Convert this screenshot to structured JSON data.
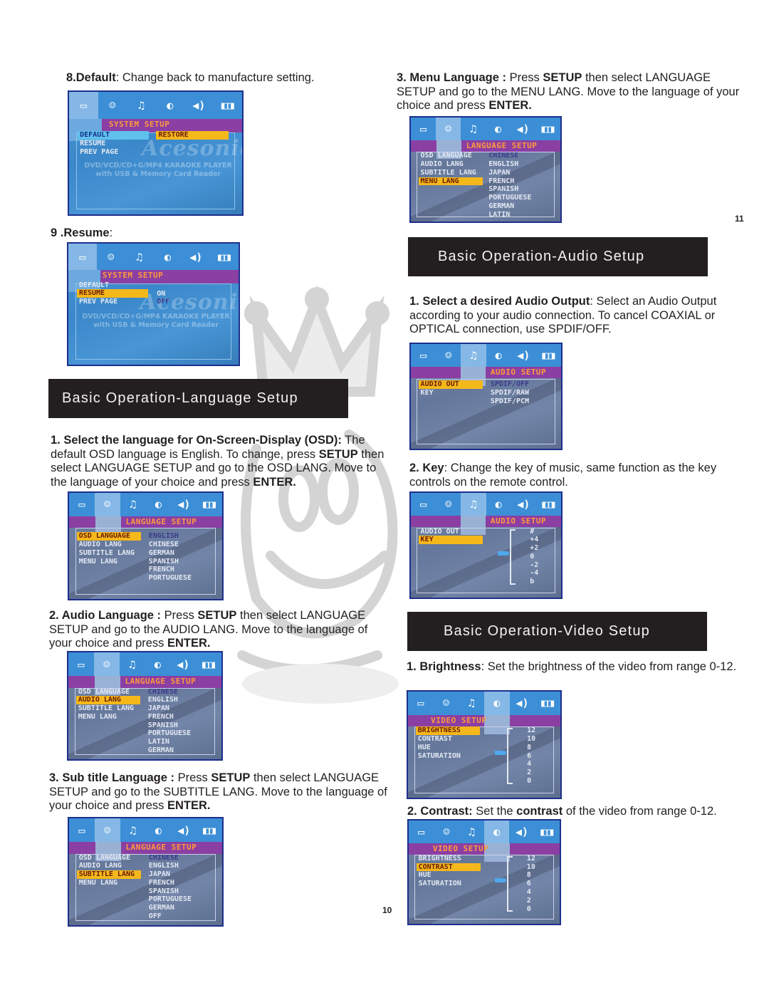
{
  "page_numbers": {
    "left": "10",
    "right": "11"
  },
  "osd_tabs": [
    {
      "icon": "monitor-icon",
      "glyph": "▭"
    },
    {
      "icon": "language-person-icon",
      "glyph": "☺"
    },
    {
      "icon": "music-note-icon",
      "glyph": "♫"
    },
    {
      "icon": "video-disc-icon",
      "glyph": "◐"
    },
    {
      "icon": "speaker-icon",
      "glyph": "◀)"
    },
    {
      "icon": "dolby-icon",
      "glyph": "◧◨"
    }
  ],
  "left": {
    "default": {
      "num": "8.",
      "label": "Default",
      "text": ": Change back to manufacture setting.",
      "screen": {
        "title": "SYSTEM SETUP",
        "items": [
          "DEFAULT",
          "RESUME",
          "PREV PAGE"
        ],
        "selected_item": "DEFAULT",
        "option": "RESTORE",
        "brand": "Acesonic",
        "brand_line1": "DVD/VCD/CD+G/MP4 KARAOKE PLAYER",
        "brand_line2": "with USB & Memory Card Reader"
      }
    },
    "resume": {
      "num": "9 .",
      "label": "Resume",
      "text": ":",
      "screen": {
        "title": "SYSTEM SETUP",
        "items": [
          "DEFAULT",
          "RESUME",
          "PREV PAGE"
        ],
        "selected_item": "RESUME",
        "options": [
          "ON",
          "OFF"
        ],
        "brand": "Acesonic",
        "brand_line1": "DVD/VCD/CD+G/MP4 KARAOKE PLAYER",
        "brand_line2": "with USB & Memory Card Reader"
      }
    },
    "language_banner": "Basic Operation-Language Setup",
    "osd_lang": {
      "bold": "1. Select the language for On-Screen-Display (OSD):",
      "t1": " The default OSD language is English. To change, press ",
      "b2": "SETUP",
      "t2": " then select LANGUAGE  SETUP and go to the OSD LANG. Move to the language of your choice and press ",
      "b3": "ENTER.",
      "screen": {
        "title": "LANGUAGE SETUP",
        "items": [
          "OSD LANGUAGE",
          "AUDIO LANG",
          "SUBTITLE LANG",
          "MENU LANG"
        ],
        "selected_item": "OSD LANGUAGE",
        "options": [
          "ENGLISH",
          "CHINESE",
          "GERMAN",
          "SPANISH",
          "FRENCH",
          "PORTUGUESE"
        ]
      }
    },
    "audio_lang": {
      "bold": "2. Audio Language :",
      "t1": " Press ",
      "b2": "SETUP",
      "t2": " then  select LANGUAGE  SETUP and go to the AUDIO LANG. Move to the language of your choice and press ",
      "b3": "ENTER.",
      "screen": {
        "title": "LANGUAGE SETUP",
        "items": [
          "OSD LANGUAGE",
          "AUDIO LANG",
          "SUBTITLE LANG",
          "MENU LANG"
        ],
        "selected_item": "AUDIO LANG",
        "options": [
          "CHINESE",
          "ENGLISH",
          "JAPAN",
          "FRENCH",
          "SPANISH",
          "PORTUGUESE",
          "LATIN",
          "GERMAN"
        ]
      }
    },
    "subtitle_lang": {
      "bold": "3. Sub title Language :",
      "t1": " Press ",
      "b2": "SETUP",
      "t2": " then  select LANGUAGE  SETUP and go to the SUBTITLE LANG. Move to the language of your choice and press ",
      "b3": "ENTER.",
      "screen": {
        "title": "LANGUAGE SETUP",
        "items": [
          "OSD LANGUAGE",
          "AUDIO LANG",
          "SUBTITLE LANG",
          "MENU LANG"
        ],
        "selected_item": "SUBTITLE LANG",
        "options": [
          "CHINESE",
          "ENGLISH",
          "JAPAN",
          "FRENCH",
          "SPANISH",
          "PORTUGUESE",
          "GERMAN",
          "OFF"
        ]
      }
    }
  },
  "right": {
    "menu_lang": {
      "bold": "3. Menu Language :",
      "t1": " Press ",
      "b2": "SETUP",
      "t2": " then  select LANGUAGE  SETUP and go to the MENU LANG. Move to the language of your choice and press ",
      "b3": "ENTER.",
      "screen": {
        "title": "LANGUAGE SETUP",
        "items": [
          "OSD LANGUAGE",
          "AUDIO LANG",
          "SUBTITLE LANG",
          "MENU LANG"
        ],
        "selected_item": "MENU LANG",
        "options": [
          "CHINESE",
          "ENGLISH",
          "JAPAN",
          "FRENCH",
          "SPANISH",
          "PORTUGUESE",
          "GERMAN",
          "LATIN"
        ]
      }
    },
    "audio_banner": "Basic Operation-Audio Setup",
    "audio_out": {
      "bold": "1. Select a desired Audio Output",
      "t1": ": Select an Audio Output according to your audio connection. To cancel COAXIAL or OPTICAL connection, use SPDIF/OFF.",
      "screen": {
        "title": "AUDIO SETUP",
        "items": [
          "AUDIO OUT",
          "KEY"
        ],
        "selected_item": "AUDIO OUT",
        "options": [
          "SPDIF/OFF",
          "SPDIF/RAW",
          "SPDIF/PCM"
        ]
      }
    },
    "key": {
      "bold": "2. Key",
      "t1": ": Change the key of music, same function as the key controls  on the remote control.",
      "screen": {
        "title": "AUDIO SETUP",
        "items": [
          "AUDIO OUT",
          "KEY"
        ],
        "selected_item": "KEY",
        "scale": [
          "#",
          "+4",
          "+2",
          "0",
          "-2",
          "-4",
          "b"
        ],
        "current": "0"
      }
    },
    "video_banner": "Basic Operation-Video Setup",
    "brightness": {
      "bold": "1. Brightness",
      "t1": ": Set the brightness of the video from range 0-12.",
      "screen": {
        "title": "VIDEO SETUP",
        "items": [
          "BRIGHTNESS",
          "CONTRAST",
          "HUE",
          "SATURATION"
        ],
        "selected_item": "BRIGHTNESS",
        "scale": [
          "12",
          "10",
          "8",
          "6",
          "4",
          "2",
          "0"
        ],
        "current": "6"
      }
    },
    "contrast": {
      "bold": "2. Contrast:",
      "t1": " Set the ",
      "b2": "contrast",
      "t2": " of the video from range 0-12.",
      "screen": {
        "title": "VIDEO SETUP",
        "items": [
          "BRIGHTNESS",
          "CONTRAST",
          "HUE",
          "SATURATION"
        ],
        "selected_item": "CONTRAST",
        "scale": [
          "12",
          "10",
          "8",
          "6",
          "4",
          "2",
          "0"
        ],
        "current": "6"
      }
    }
  }
}
